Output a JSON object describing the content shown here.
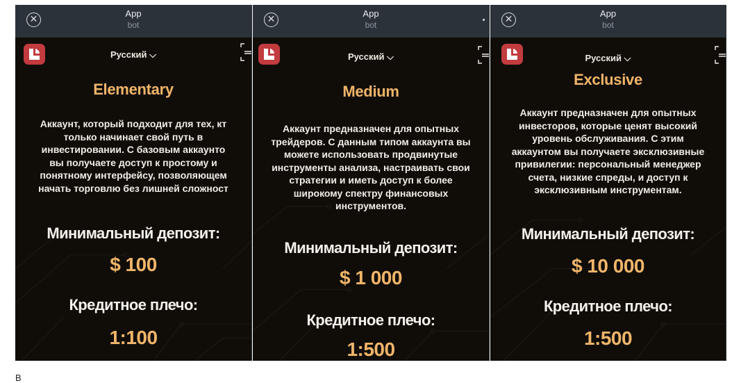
{
  "colors": {
    "accent": "#f0b569",
    "panel_bg": "#100d09",
    "titlebar_bg": "#2b323a",
    "logo_bg": "#c23b3f"
  },
  "panels": [
    {
      "app_title": "App",
      "app_subtitle": "bot",
      "language": "Русский",
      "account_name": "Elementary",
      "description_lines": [
        "Аккаунт, который подходит для тех, кт",
        "только начинает свой путь в",
        "инвестировании. С базовым аккаунто",
        "вы получаете доступ к простому и",
        "понятному интерфейсу, позволяющем",
        "начать торговлю без лишней сложност"
      ],
      "deposit_label": "Минимальный депозит:",
      "deposit_value": "$ 100",
      "leverage_label": "Кредитное плечо:",
      "leverage_value": "1:100"
    },
    {
      "app_title": "App",
      "app_subtitle": "bot",
      "language": "Русский",
      "account_name": "Medium",
      "description_lines": [
        "Аккаунт предназначен для опытных",
        "трейдеров. С данным типом аккаунта вы",
        "можете использовать продвинутые",
        "инструменты анализа, настраивать свои",
        "стратегии и иметь доступ к более",
        "широкому спектру финансовых",
        "инструментов."
      ],
      "deposit_label": "Минимальный депозит:",
      "deposit_value": "$ 1 000",
      "leverage_label": "Кредитное плечо:",
      "leverage_value": "1:500"
    },
    {
      "app_title": "App",
      "app_subtitle": "bot",
      "language": "Русский",
      "account_name": "Exclusive",
      "description_lines": [
        "Аккаунт предназначен для опытных",
        "инвесторов, которые ценят высокий",
        "уровень обслуживания. С этим",
        "аккаунтом вы получаете эксклюзивные",
        "привилегии: персональный менеджер",
        "счета, низкие спреды, и доступ к",
        "эксклюзивным инструментам."
      ],
      "deposit_label": "Минимальный депозит:",
      "deposit_value": "$ 10 000",
      "leverage_label": "Кредитное плечо:",
      "leverage_value": "1:500"
    }
  ],
  "footer_text": "В"
}
